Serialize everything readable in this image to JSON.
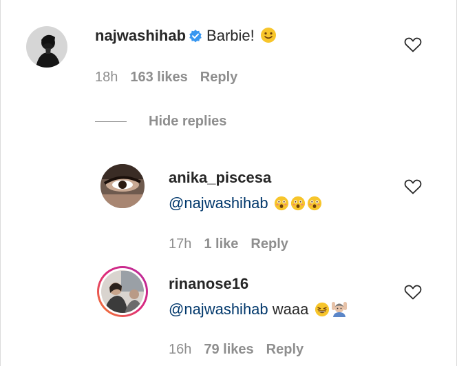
{
  "comments": [
    {
      "username": "najwashihab",
      "text": "Barbie!",
      "emoji": "slightly-smiling-face-icon",
      "verified": true,
      "age": "18h",
      "likes": "163 likes",
      "reply_label": "Reply"
    }
  ],
  "hide_replies_label": "Hide replies",
  "replies": [
    {
      "username": "anika_piscesa",
      "mention": "@najwashihab",
      "text": "",
      "emoji": "astonished-face-icon x3",
      "age": "17h",
      "likes": "1 like",
      "reply_label": "Reply"
    },
    {
      "username": "rinanose16",
      "mention": "@najwashihab",
      "text": "waaa",
      "emoji": "laughing-face-icon, person-raising-hands-icon",
      "age": "16h",
      "likes": "79 likes",
      "reply_label": "Reply"
    }
  ],
  "colors": {
    "text": "#262626",
    "meta": "#8e8e8e",
    "mention": "#00376b",
    "verified": "#3897f0",
    "story_ring_start": "#f58529",
    "story_ring_end": "#dd2a7b"
  }
}
